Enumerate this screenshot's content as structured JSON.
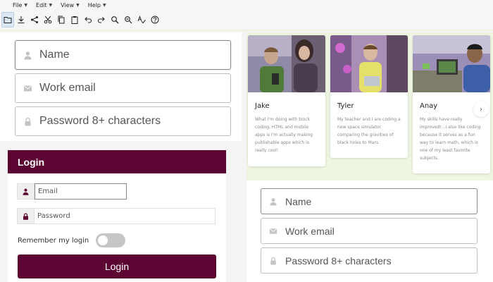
{
  "menubar": {
    "items": [
      {
        "label": "File"
      },
      {
        "label": "Edit"
      },
      {
        "label": "View"
      },
      {
        "label": "Help"
      }
    ]
  },
  "toolbar": {
    "buttons": [
      {
        "icon": "folder-icon"
      },
      {
        "icon": "download-icon"
      },
      {
        "icon": "share-icon"
      },
      {
        "icon": "cut-icon"
      },
      {
        "icon": "copy-icon"
      },
      {
        "icon": "paste-icon"
      },
      {
        "icon": "undo-icon"
      },
      {
        "icon": "redo-icon"
      },
      {
        "icon": "zoom-in-icon"
      },
      {
        "icon": "zoom-out-icon"
      },
      {
        "icon": "spellcheck-icon"
      },
      {
        "icon": "help-icon"
      }
    ]
  },
  "signup_form_top": {
    "name_placeholder": "Name",
    "email_placeholder": "Work email",
    "password_placeholder": "Password 8+ characters"
  },
  "login": {
    "title": "Login",
    "email_placeholder": "Email",
    "password_placeholder": "Password",
    "remember_label": "Remember my login",
    "remember_on": false,
    "button_label": "Login"
  },
  "testimonials": [
    {
      "name": "Jake",
      "quote": "What I'm doing with block coding, HTML and mobile apps is I'm actually making publishable apps which is really cool!"
    },
    {
      "name": "Tyler",
      "quote": "My teacher and I are coding a new space simulator comparing the gravities of black holes to Mars."
    },
    {
      "name": "Anay",
      "quote": "My skills have really improved!...I also like coding because it serves as a fun way to learn math, which is one of my least favorite subjects."
    }
  ],
  "signup_form_bottom": {
    "name_placeholder": "Name",
    "email_placeholder": "Work email",
    "password_placeholder": "Password 8+ characters"
  },
  "colors": {
    "brand": "#5c0532",
    "card_area_bg": "#eef6e2",
    "page_bg": "#f4f4f4"
  }
}
